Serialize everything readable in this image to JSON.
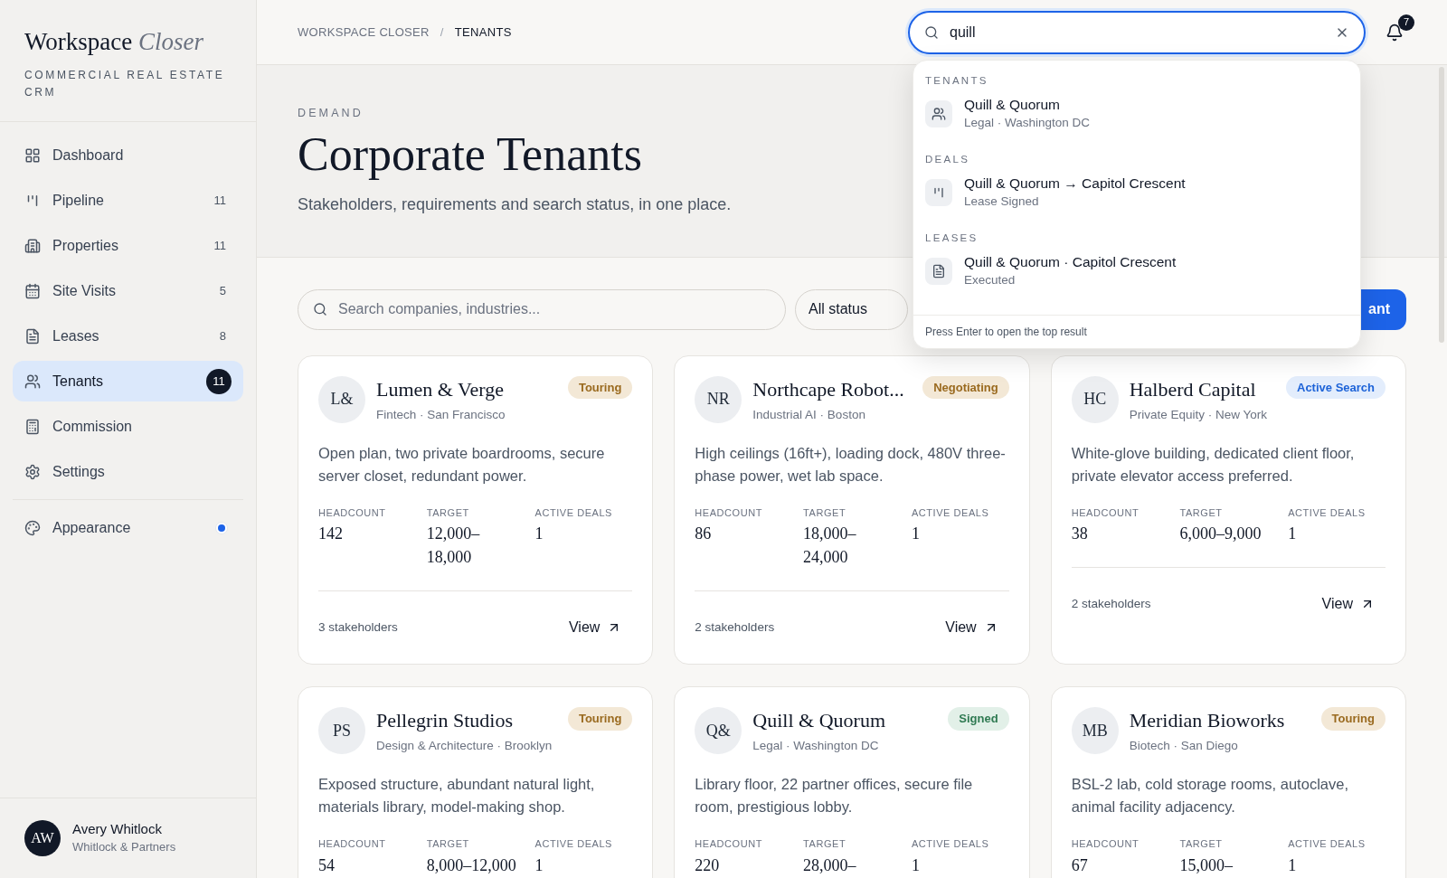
{
  "sidebar": {
    "brand": {
      "word": "Workspace",
      "accent": "Closer"
    },
    "tagline": "COMMERCIAL REAL ESTATE CRM",
    "items": [
      {
        "kind": "dashboard",
        "label": "Dashboard",
        "selected": false
      },
      {
        "kind": "pipeline",
        "label": "Pipeline",
        "count": "11",
        "selected": false
      },
      {
        "kind": "properties",
        "label": "Properties",
        "count": "11",
        "selected": false
      },
      {
        "kind": "visits",
        "label": "Site Visits",
        "count": "5",
        "selected": false
      },
      {
        "kind": "leases",
        "label": "Leases",
        "count": "8",
        "selected": false
      },
      {
        "kind": "tenants",
        "label": "Tenants",
        "count": "11",
        "selected": true
      },
      {
        "kind": "commission",
        "label": "Commission",
        "selected": false
      },
      {
        "kind": "settings",
        "label": "Settings",
        "selected": false
      }
    ],
    "appearance": {
      "label": "Appearance",
      "indicator": true
    },
    "user": {
      "initials": "AW",
      "name": "Avery Whitlock",
      "company": "Whitlock & Partners"
    }
  },
  "breadcrumb": {
    "items": [
      "WORKSPACE CLOSER",
      "TENANTS"
    ],
    "separator": "/"
  },
  "global_search": {
    "value": "quill",
    "notifications": "7",
    "results": [
      {
        "section": "TENANTS",
        "kind": "tenant",
        "title": "Quill & Quorum",
        "subtitle": "Legal · Washington DC"
      },
      {
        "section": "DEALS",
        "kind": "deal",
        "title": "Quill & Quorum → Capitol Crescent",
        "subtitle": "Lease Signed"
      },
      {
        "section": "LEASES",
        "kind": "lease",
        "title": "Quill & Quorum · Capitol Crescent",
        "subtitle": "Executed"
      }
    ],
    "hint": "Press Enter to open the top result"
  },
  "hero": {
    "eyebrow": "DEMAND",
    "title": "Corporate Tenants",
    "subtitle": "Stakeholders, requirements and search status, in one place."
  },
  "filters": {
    "search_placeholder": "Search companies, industries...",
    "status": "All status",
    "button": "ant"
  },
  "cards": [
    {
      "initials": "L&",
      "name": "Lumen & Verge",
      "meta": "Fintech · San Francisco",
      "status": "Touring",
      "kind": "touring",
      "description": "Open plan, two private boardrooms, secure server closet, redundant power.",
      "stats": [
        {
          "label": "HEADCOUNT",
          "value": "142"
        },
        {
          "label": "TARGET",
          "value": "12,000–18,000"
        },
        {
          "label": "ACTIVE DEALS",
          "value": "1"
        }
      ],
      "stakeholders": "3 stakeholders",
      "action": "View"
    },
    {
      "initials": "NR",
      "name": "Northcape Robot...",
      "meta": "Industrial AI · Boston",
      "status": "Negotiating",
      "kind": "negotiating",
      "description": "High ceilings (16ft+), loading dock, 480V three-phase power, wet lab space.",
      "stats": [
        {
          "label": "HEADCOUNT",
          "value": "86"
        },
        {
          "label": "TARGET",
          "value": "18,000–24,000"
        },
        {
          "label": "ACTIVE DEALS",
          "value": "1"
        }
      ],
      "stakeholders": "2 stakeholders",
      "action": "View"
    },
    {
      "initials": "HC",
      "name": "Halberd Capital",
      "meta": "Private Equity · New York",
      "status": "Active Search",
      "kind": "active",
      "description": "White-glove building, dedicated client floor, private elevator access preferred.",
      "stats": [
        {
          "label": "HEADCOUNT",
          "value": "38"
        },
        {
          "label": "TARGET",
          "value": "6,000–9,000"
        },
        {
          "label": "ACTIVE DEALS",
          "value": "1"
        }
      ],
      "stakeholders": "2 stakeholders",
      "action": "View"
    },
    {
      "initials": "PS",
      "name": "Pellegrin Studios",
      "meta": "Design & Architecture · Brooklyn",
      "status": "Touring",
      "kind": "touring",
      "description": "Exposed structure, abundant natural light, materials library, model-making shop.",
      "stats": [
        {
          "label": "HEADCOUNT",
          "value": "54"
        },
        {
          "label": "TARGET",
          "value": "8,000–12,000"
        },
        {
          "label": "ACTIVE DEALS",
          "value": "1"
        }
      ]
    },
    {
      "initials": "Q&",
      "name": "Quill & Quorum",
      "meta": "Legal · Washington DC",
      "status": "Signed",
      "kind": "signed",
      "description": "Library floor, 22 partner offices, secure file room, prestigious lobby.",
      "stats": [
        {
          "label": "HEADCOUNT",
          "value": "220"
        },
        {
          "label": "TARGET",
          "value": "28,000–"
        },
        {
          "label": "ACTIVE DEALS",
          "value": "1"
        }
      ]
    },
    {
      "initials": "MB",
      "name": "Meridian Bioworks",
      "meta": "Biotech · San Diego",
      "status": "Touring",
      "kind": "touring",
      "description": "BSL-2 lab, cold storage rooms, autoclave, animal facility adjacency.",
      "stats": [
        {
          "label": "HEADCOUNT",
          "value": "67"
        },
        {
          "label": "TARGET",
          "value": "15,000–"
        },
        {
          "label": "ACTIVE DEALS",
          "value": "1"
        }
      ]
    }
  ]
}
